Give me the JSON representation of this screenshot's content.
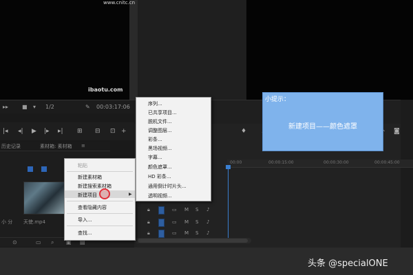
{
  "watermark": {
    "top": "www.cnitc.cn",
    "bottom": "ibaotu.com"
  },
  "source_controls": {
    "left_icons": "▸▸",
    "fit": "1/2",
    "timecode": "00:03:17:06"
  },
  "project_tabs": {
    "tab1": "历史记录",
    "tab2": "素材箱: 素材箱",
    "close": "≡"
  },
  "clip_label": "天使.mp4",
  "left_label": "小 分",
  "ruler": [
    "00:00",
    "00:00:15:00",
    "00:00:30:00",
    "00:00:45:00"
  ],
  "context_menu": {
    "items": [
      "粘贴",
      "新建素材箱",
      "新建搜索素材箱",
      "新建项目",
      "查看隐藏内容",
      "导入...",
      "查找..."
    ],
    "disabled": [
      true,
      false,
      false,
      false,
      false,
      false,
      false
    ]
  },
  "submenu": {
    "items": [
      "序列...",
      "已共享项目...",
      "脱机文件...",
      "调整图层...",
      "彩条...",
      "黑场视频...",
      "字幕...",
      "颜色遮罩...",
      "HD 彩条...",
      "通用倒计时片头...",
      "透明视频..."
    ]
  },
  "tip": {
    "title": "小提示：",
    "body": "新建项目——颜色遮罩"
  },
  "brand": "头条 @specialONE",
  "icons": {
    "play": "play-icon",
    "step-back": "step-back-icon",
    "step-forward": "step-forward-icon",
    "wrench": "wrench-icon",
    "camera": "camera-icon",
    "add": "add-icon",
    "search": "search-icon",
    "folder": "folder-icon",
    "lock": "lock-icon",
    "eye": "eye-icon",
    "mic": "mic-icon"
  }
}
